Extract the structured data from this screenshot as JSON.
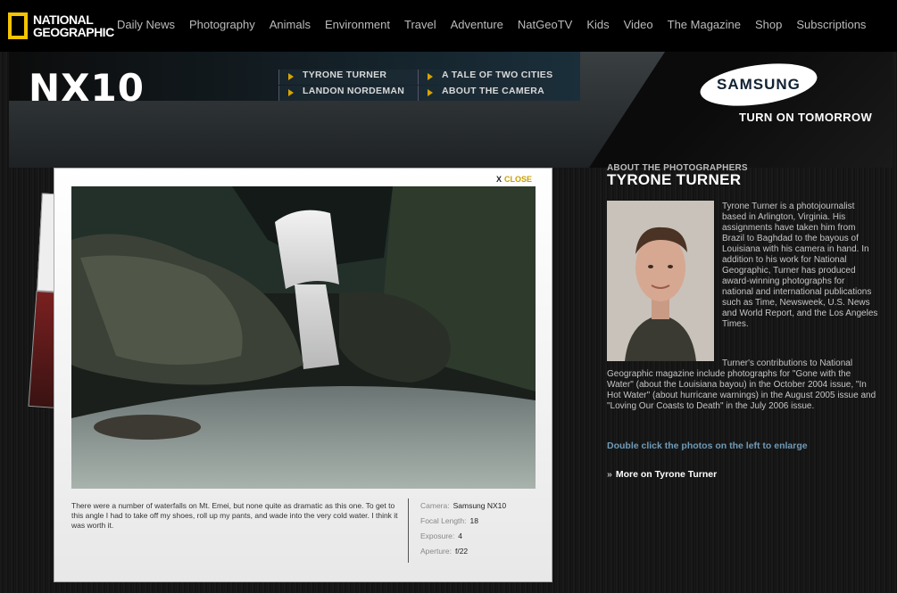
{
  "site": {
    "logo_line1": "NATIONAL",
    "logo_line2": "GEOGRAPHIC",
    "nav": [
      "Daily News",
      "Photography",
      "Animals",
      "Environment",
      "Travel",
      "Adventure",
      "NatGeoTV",
      "Kids",
      "Video",
      "The Magazine",
      "Shop",
      "Subscriptions"
    ]
  },
  "header": {
    "product": "NX10",
    "menu": [
      "TYRONE TURNER",
      "A TALE OF TWO CITIES",
      "LANDON NORDEMAN",
      "ABOUT THE CAMERA"
    ],
    "sponsor": "SAMSUNG",
    "tagline": "TURN ON TOMORROW"
  },
  "viewer": {
    "close_x": "X",
    "close_label": "CLOSE",
    "caption": "There were a number of waterfalls on Mt. Emei, but none quite as dramatic as this one. To get to this angle I had to take off my shoes, roll up my pants, and wade into the very cold water. I think it was worth it.",
    "exif": [
      {
        "label": "Camera:",
        "value": "Samsung NX10"
      },
      {
        "label": "Focal Length:",
        "value": "18"
      },
      {
        "label": "Exposure:",
        "value": "4"
      },
      {
        "label": "Aperture:",
        "value": "f/22"
      }
    ]
  },
  "about": {
    "kicker": "ABOUT THE PHOTOGRAPHERS",
    "name": "TYRONE TURNER",
    "bio1": "Tyrone Turner is a photojournalist based in Arlington, Virginia. His assignments have taken him from Brazil to Baghdad to the bayous of Louisiana with his camera in hand. In addition to his work for National Geographic, Turner has produced award-winning photographs for national and international publications such as Time, Newsweek, U.S. News and World Report, and the Los Angeles Times.",
    "bio2": "Turner's contributions to National Geographic magazine include photographs for \"Gone with the Water\" (about the Louisiana bayou) in the October 2004 issue, \"In Hot Water\" (about hurricane warnings) in the August 2005 issue and \"Loving Our Coasts to Death\" in the July 2006 issue.",
    "hint": "Double click the photos on the left to enlarge",
    "more_chevron": "»",
    "more": "More on Tyrone Turner"
  }
}
